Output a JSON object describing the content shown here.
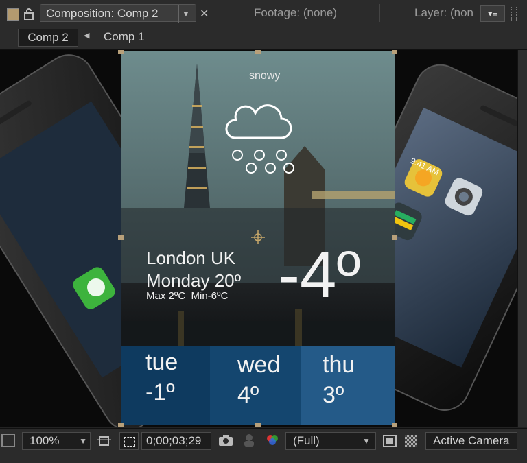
{
  "tabs": {
    "composition": "Composition: Comp 2",
    "footage": "Footage: (none)",
    "layer": "Layer: (non"
  },
  "breadcrumbs": {
    "current": "Comp 2",
    "parent": "Comp 1"
  },
  "weather": {
    "condition": "snowy",
    "city": "London UK",
    "date": "Monday 20º",
    "range": "Max 2ºC  Min-6ºC",
    "temp": "-4º",
    "forecast": [
      {
        "day": "tue",
        "temp": "-1º",
        "color": "#0e3a5f"
      },
      {
        "day": "wed",
        "temp": "4º",
        "color": "#14466f"
      },
      {
        "day": "thu",
        "temp": "3º",
        "color": "#245a88"
      }
    ]
  },
  "phone": {
    "time": "9:41 AM",
    "apps": [
      "Phone",
      "Photos",
      "Camera",
      "Passbook"
    ]
  },
  "status": {
    "zoom": "100%",
    "timecode": "0;00;03;29",
    "resolution": "(Full)",
    "camera": "Active Camera"
  },
  "colors": {
    "accent": "#b8a07a",
    "panel": "#2b2b2b",
    "forecast_bar": "#14466f"
  }
}
